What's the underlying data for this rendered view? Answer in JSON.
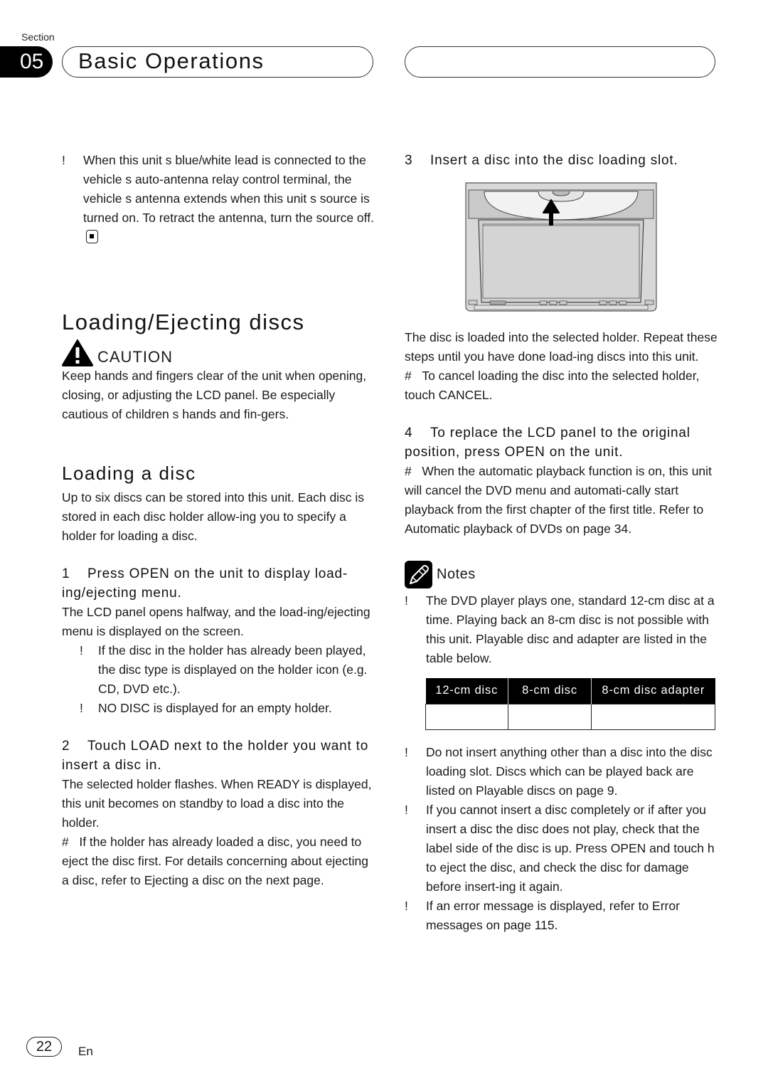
{
  "header": {
    "section_label": "Section",
    "section_number": "05",
    "section_title": "Basic Operations"
  },
  "left": {
    "intro_bullet": {
      "mark": "!",
      "text": "When this unit s blue/white lead is connected to the vehicle s auto-antenna relay control terminal, the vehicle s antenna extends when this unit s source is turned on. To retract the antenna, turn the source off."
    },
    "heading": "Loading/Ejecting discs",
    "caution": {
      "label": "CAUTION",
      "text": "Keep hands and fingers clear of the unit when opening, closing, or adjusting the LCD panel. Be especially cautious of children s hands and fin-gers."
    },
    "subheading": "Loading a disc",
    "intro_paragraph": "Up to six discs can be stored into this unit. Each disc is stored in each disc holder allow-ing you to specify a holder for loading a disc.",
    "step1": {
      "num": "1",
      "title": "Press OPEN on the unit to display load-ing/ejecting menu.",
      "body": "The LCD panel opens halfway, and the load-ing/ejecting menu is displayed on the screen.",
      "bullets": [
        {
          "mark": "!",
          "text": "If the disc in the holder has already been played, the disc type is displayed on the holder icon (e.g. CD, DVD etc.)."
        },
        {
          "mark": "!",
          "text": "NO DISC is displayed for an empty holder."
        }
      ]
    },
    "step2": {
      "num": "2",
      "title": "Touch LOAD next to the holder you want to insert a disc in.",
      "body": "The selected holder flashes. When READY is displayed, this unit becomes on standby to load a disc into the holder.",
      "hash_note": {
        "mark": "#",
        "text": "If the holder has already loaded a disc, you need to eject the disc first. For details concerning about ejecting a disc, refer to Ejecting a disc on the next page."
      }
    }
  },
  "right": {
    "step3": {
      "num": "3",
      "title": "Insert a disc into the disc loading slot.",
      "body": "The disc is loaded into the selected holder. Repeat these steps until you have done load-ing discs into this unit.",
      "hash_note": {
        "mark": "#",
        "text": "To cancel loading the disc into the selected holder, touch CANCEL."
      }
    },
    "step4": {
      "num": "4",
      "title": "To replace the LCD panel to the original position, press OPEN on the unit.",
      "hash_note": {
        "mark": "#",
        "text": "When the automatic playback function is on, this unit will cancel the DVD menu and automati-cally start playback from the first chapter of the first title. Refer to Automatic playback of DVDs on page 34."
      }
    },
    "notes": {
      "label": "Notes",
      "first_bullet": {
        "mark": "!",
        "text": "The DVD player plays one, standard 12-cm disc at a time. Playing back an 8-cm disc is not possible with this unit. Playable disc and adapter are listed in the table below."
      },
      "table": {
        "headers": [
          "12-cm disc",
          "8-cm disc",
          "8-cm disc adapter"
        ],
        "rows": [
          [
            "",
            "",
            ""
          ]
        ]
      },
      "bullets": [
        {
          "mark": "!",
          "text": "Do not insert anything other than a disc into the disc loading slot. Discs which can be played back are listed on Playable discs on page 9."
        },
        {
          "mark": "!",
          "text": "If you cannot insert a disc completely or if after you insert a disc the disc does not play, check that the label side of the disc is up. Press OPEN and touch h  to eject the disc, and check the disc for damage before insert-ing it again."
        },
        {
          "mark": "!",
          "text": "If an error message is displayed, refer to Error messages on page 115."
        }
      ]
    }
  },
  "footer": {
    "page_number": "22",
    "language": "En"
  }
}
